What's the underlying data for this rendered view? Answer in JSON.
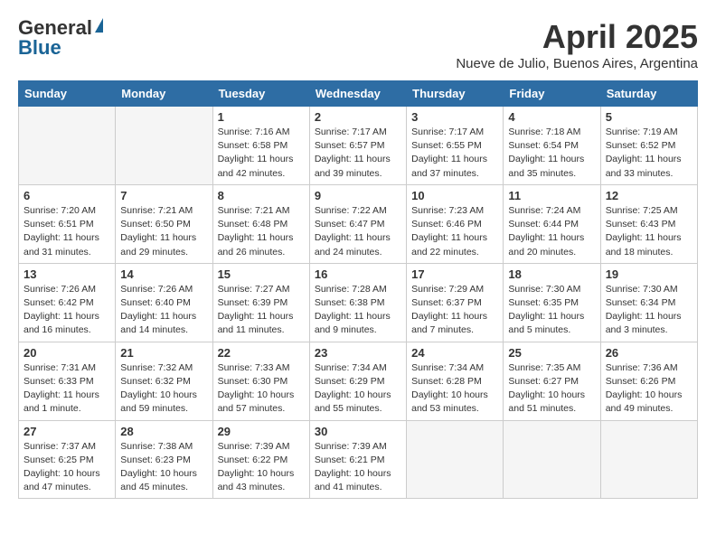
{
  "logo": {
    "general": "General",
    "blue": "Blue"
  },
  "title": "April 2025",
  "subtitle": "Nueve de Julio, Buenos Aires, Argentina",
  "days_of_week": [
    "Sunday",
    "Monday",
    "Tuesday",
    "Wednesday",
    "Thursday",
    "Friday",
    "Saturday"
  ],
  "weeks": [
    [
      {
        "day": "",
        "info": ""
      },
      {
        "day": "",
        "info": ""
      },
      {
        "day": "1",
        "info": "Sunrise: 7:16 AM\nSunset: 6:58 PM\nDaylight: 11 hours and 42 minutes."
      },
      {
        "day": "2",
        "info": "Sunrise: 7:17 AM\nSunset: 6:57 PM\nDaylight: 11 hours and 39 minutes."
      },
      {
        "day": "3",
        "info": "Sunrise: 7:17 AM\nSunset: 6:55 PM\nDaylight: 11 hours and 37 minutes."
      },
      {
        "day": "4",
        "info": "Sunrise: 7:18 AM\nSunset: 6:54 PM\nDaylight: 11 hours and 35 minutes."
      },
      {
        "day": "5",
        "info": "Sunrise: 7:19 AM\nSunset: 6:52 PM\nDaylight: 11 hours and 33 minutes."
      }
    ],
    [
      {
        "day": "6",
        "info": "Sunrise: 7:20 AM\nSunset: 6:51 PM\nDaylight: 11 hours and 31 minutes."
      },
      {
        "day": "7",
        "info": "Sunrise: 7:21 AM\nSunset: 6:50 PM\nDaylight: 11 hours and 29 minutes."
      },
      {
        "day": "8",
        "info": "Sunrise: 7:21 AM\nSunset: 6:48 PM\nDaylight: 11 hours and 26 minutes."
      },
      {
        "day": "9",
        "info": "Sunrise: 7:22 AM\nSunset: 6:47 PM\nDaylight: 11 hours and 24 minutes."
      },
      {
        "day": "10",
        "info": "Sunrise: 7:23 AM\nSunset: 6:46 PM\nDaylight: 11 hours and 22 minutes."
      },
      {
        "day": "11",
        "info": "Sunrise: 7:24 AM\nSunset: 6:44 PM\nDaylight: 11 hours and 20 minutes."
      },
      {
        "day": "12",
        "info": "Sunrise: 7:25 AM\nSunset: 6:43 PM\nDaylight: 11 hours and 18 minutes."
      }
    ],
    [
      {
        "day": "13",
        "info": "Sunrise: 7:26 AM\nSunset: 6:42 PM\nDaylight: 11 hours and 16 minutes."
      },
      {
        "day": "14",
        "info": "Sunrise: 7:26 AM\nSunset: 6:40 PM\nDaylight: 11 hours and 14 minutes."
      },
      {
        "day": "15",
        "info": "Sunrise: 7:27 AM\nSunset: 6:39 PM\nDaylight: 11 hours and 11 minutes."
      },
      {
        "day": "16",
        "info": "Sunrise: 7:28 AM\nSunset: 6:38 PM\nDaylight: 11 hours and 9 minutes."
      },
      {
        "day": "17",
        "info": "Sunrise: 7:29 AM\nSunset: 6:37 PM\nDaylight: 11 hours and 7 minutes."
      },
      {
        "day": "18",
        "info": "Sunrise: 7:30 AM\nSunset: 6:35 PM\nDaylight: 11 hours and 5 minutes."
      },
      {
        "day": "19",
        "info": "Sunrise: 7:30 AM\nSunset: 6:34 PM\nDaylight: 11 hours and 3 minutes."
      }
    ],
    [
      {
        "day": "20",
        "info": "Sunrise: 7:31 AM\nSunset: 6:33 PM\nDaylight: 11 hours and 1 minute."
      },
      {
        "day": "21",
        "info": "Sunrise: 7:32 AM\nSunset: 6:32 PM\nDaylight: 10 hours and 59 minutes."
      },
      {
        "day": "22",
        "info": "Sunrise: 7:33 AM\nSunset: 6:30 PM\nDaylight: 10 hours and 57 minutes."
      },
      {
        "day": "23",
        "info": "Sunrise: 7:34 AM\nSunset: 6:29 PM\nDaylight: 10 hours and 55 minutes."
      },
      {
        "day": "24",
        "info": "Sunrise: 7:34 AM\nSunset: 6:28 PM\nDaylight: 10 hours and 53 minutes."
      },
      {
        "day": "25",
        "info": "Sunrise: 7:35 AM\nSunset: 6:27 PM\nDaylight: 10 hours and 51 minutes."
      },
      {
        "day": "26",
        "info": "Sunrise: 7:36 AM\nSunset: 6:26 PM\nDaylight: 10 hours and 49 minutes."
      }
    ],
    [
      {
        "day": "27",
        "info": "Sunrise: 7:37 AM\nSunset: 6:25 PM\nDaylight: 10 hours and 47 minutes."
      },
      {
        "day": "28",
        "info": "Sunrise: 7:38 AM\nSunset: 6:23 PM\nDaylight: 10 hours and 45 minutes."
      },
      {
        "day": "29",
        "info": "Sunrise: 7:39 AM\nSunset: 6:22 PM\nDaylight: 10 hours and 43 minutes."
      },
      {
        "day": "30",
        "info": "Sunrise: 7:39 AM\nSunset: 6:21 PM\nDaylight: 10 hours and 41 minutes."
      },
      {
        "day": "",
        "info": ""
      },
      {
        "day": "",
        "info": ""
      },
      {
        "day": "",
        "info": ""
      }
    ]
  ]
}
